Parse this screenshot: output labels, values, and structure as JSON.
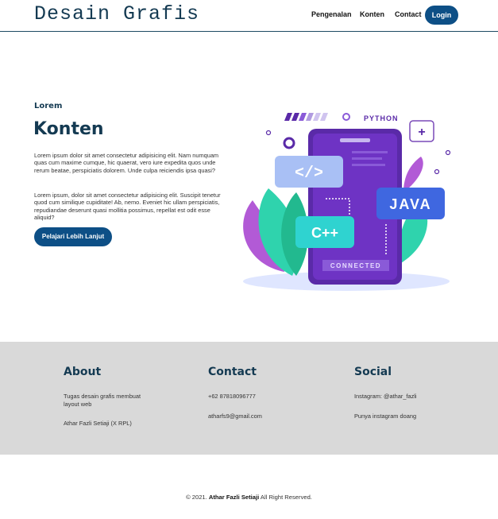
{
  "brand": "Desain Grafis",
  "nav": {
    "items": [
      "Pengenalan",
      "Konten",
      "Contact"
    ],
    "login": "Login"
  },
  "hero": {
    "eyebrow": "Lorem",
    "title": "Konten",
    "paragraphs": [
      "Lorem ipsum dolor sit amet consectetur adipisicing elit. Nam numquam quas cum maxime cumque, hic quaerat, vero iure expedita quos unde rerum beatae, perspiciatis dolorem. Unde culpa reiciendis ipsa quasi?",
      "Lorem ipsum, dolor sit amet consectetur adipisicing elit. Suscipit tenetur quod cum similique cupiditate! Ab, nemo. Eveniet hic ullam perspiciatis, repudiandae deserunt quasi mollitia possimus, repellat est odit esse aliquid?"
    ],
    "cta": "Pelajari Lebih Lanjut"
  },
  "illustration": {
    "labels": [
      "PYTHON",
      "</>",
      "JAVA",
      "C++",
      "CONNECTED",
      "+"
    ]
  },
  "footer": {
    "about": {
      "title": "About",
      "lines": [
        "Tugas desain grafis membuat layout web",
        "Athar Fazli Setiaji (X RPL)"
      ]
    },
    "contact": {
      "title": "Contact",
      "lines": [
        "+62 87818096777",
        "atharfs9@gmail.com"
      ]
    },
    "social": {
      "title": "Social",
      "lines": [
        "Instagram: @athar_fazli",
        "Punya instagram doang"
      ]
    }
  },
  "copyright": {
    "prefix": "© 2021.",
    "name": "Athar Fazli Setiaji",
    "suffix": "All Right Reserved."
  },
  "colors": {
    "primary": "#0d4f86",
    "heading": "#143a52",
    "footer_bg": "#d9d9d9"
  }
}
